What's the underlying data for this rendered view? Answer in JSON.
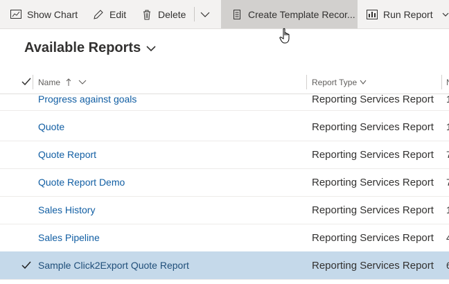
{
  "toolbar": {
    "show_chart": "Show Chart",
    "edit": "Edit",
    "delete": "Delete",
    "create_template": "Create Template Recor...",
    "run_report": "Run Report"
  },
  "view": {
    "title": "Available Reports"
  },
  "grid": {
    "columns": {
      "name": "Name",
      "report_type": "Report Type",
      "partial_col": "N"
    },
    "rows": [
      {
        "name": "Progress against goals",
        "type": "Reporting Services Report",
        "extra": "1"
      },
      {
        "name": "Quote",
        "type": "Reporting Services Report",
        "extra": "1"
      },
      {
        "name": "Quote Report",
        "type": "Reporting Services Report",
        "extra": "7"
      },
      {
        "name": "Quote Report Demo",
        "type": "Reporting Services Report",
        "extra": "7"
      },
      {
        "name": "Sales History",
        "type": "Reporting Services Report",
        "extra": "1"
      },
      {
        "name": "Sales Pipeline",
        "type": "Reporting Services Report",
        "extra": "4"
      },
      {
        "name": "Sample Click2Export Quote Report",
        "type": "Reporting Services Report",
        "extra": "6",
        "selected": true
      }
    ]
  },
  "colors": {
    "toolbar_bg": "#f3f2f1",
    "hover_bg": "#d2d0ce",
    "link": "#115ea3",
    "selected_row": "#c5d9ea"
  }
}
